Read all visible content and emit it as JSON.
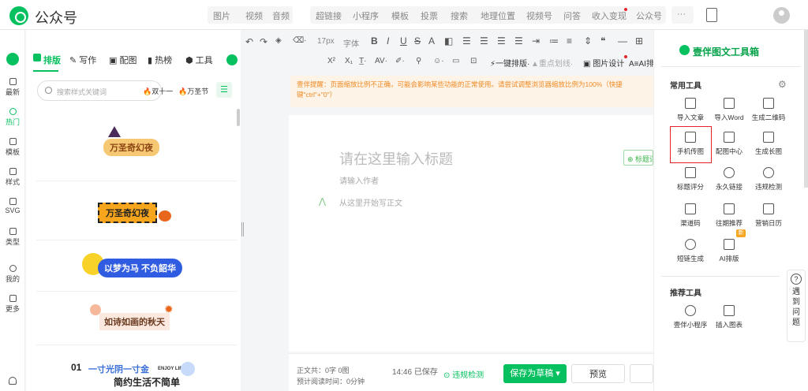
{
  "app": {
    "brand": "公众号"
  },
  "top_nav": {
    "group1": [
      "图片",
      "视频",
      "音频"
    ],
    "group2": [
      "超链接",
      "小程序",
      "模板",
      "投票",
      "搜索",
      "地理位置",
      "视频号",
      "问答",
      "收入变现",
      "公众号"
    ],
    "more": "···"
  },
  "left_rail": [
    "最新",
    "热门",
    "模板",
    "样式",
    "SVG",
    "类型",
    "我的",
    "更多"
  ],
  "panel": {
    "tabs": [
      "排版",
      "写作",
      "配图",
      "热榜",
      "工具"
    ],
    "search_placeholder": "搜索样式关键词",
    "tags": [
      "双十一",
      "万圣节"
    ],
    "templates": [
      "万圣奇幻夜",
      "万圣奇幻夜",
      "以梦为马 不负韶华",
      "如诗如画的秋天",
      "一寸光阴一寸金",
      "ENJOY LIFE",
      "简约生活不简单",
      "01"
    ]
  },
  "toolbar": {
    "font_size": "17px",
    "font_label": "字体",
    "one_key": "一键排版",
    "divider_label": "重点划线",
    "image_design": "图片设计",
    "ai_label": "AI排"
  },
  "notice": "壹伴提醒：页面缩放比例不正确，可能会影响某些功能的正常使用。请尝试调整浏览器缩放比例为100%（快捷键\"ctrl\"+\"0\"）",
  "editor": {
    "title_placeholder": "请在这里输入标题",
    "author_placeholder": "请输入作者",
    "body_placeholder": "从这里开始写正文",
    "title_button": "标题评"
  },
  "bottom": {
    "word_count_label": "正文共：",
    "word_count": "0字 0图",
    "read_time_label": "预计阅读时间：",
    "read_time": "0分钟",
    "save_time": "14:46",
    "save_status": "已保存",
    "check": "违规检测",
    "save_button": "保存为草稿",
    "preview_button": "预览"
  },
  "right_panel": {
    "title": "壹伴图文工具箱",
    "section_common": "常用工具",
    "tools": [
      "导入文章",
      "导入Word",
      "生成二维码",
      "手机传图",
      "配图中心",
      "生成长图",
      "标题评分",
      "永久链接",
      "违规检测",
      "渠道码",
      "往期推荐",
      "营销日历",
      "短链生成",
      "AI排版"
    ],
    "new_badge": "新",
    "section_recommend": "推荐工具",
    "recommend": [
      "壹伴小程序",
      "插入图表"
    ],
    "help": [
      "遇",
      "到",
      "问",
      "题"
    ]
  }
}
